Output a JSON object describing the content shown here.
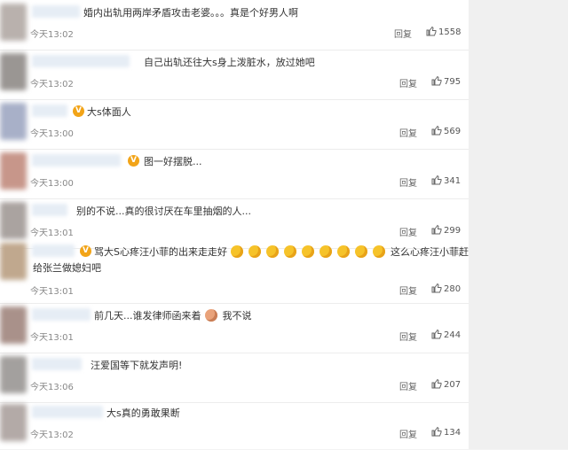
{
  "comments": [
    {
      "text": "婚内出轨用两岸矛盾攻击老婆。。。真是个好男人啊",
      "text2": "",
      "time": "今天13:02",
      "reply": "回复",
      "likes": "1558",
      "verified": false
    },
    {
      "text": "自己出轨还往大s身上泼脏水，放过她吧",
      "text2": "",
      "time": "今天13:02",
      "reply": "回复",
      "likes": "795",
      "verified": false
    },
    {
      "text": "大s体面人",
      "text2": "",
      "time": "今天13:00",
      "reply": "回复",
      "likes": "569",
      "verified": true
    },
    {
      "text": "图一好摆脱...",
      "text2": "",
      "time": "今天13:00",
      "reply": "回复",
      "likes": "341",
      "verified": true
    },
    {
      "text": "别的不说...真的很讨厌在车里抽烟的人...",
      "text2": "",
      "time": "今天13:01",
      "reply": "回复",
      "likes": "299",
      "verified": false
    },
    {
      "text": "骂大S心疼汪小菲的出来走走好",
      "text_after": "这么心疼汪小菲赶紧",
      "text2": "给张兰做媳妇吧",
      "time": "今天13:01",
      "reply": "回复",
      "likes": "280",
      "verified": true
    },
    {
      "text": "前几天...谁发律师函来着",
      "text_after": "我不说",
      "text2": "",
      "time": "今天13:01",
      "reply": "回复",
      "likes": "244",
      "verified": false
    },
    {
      "text": "汪爱国等下就发声明!",
      "text2": "",
      "time": "今天13:06",
      "reply": "回复",
      "likes": "207",
      "verified": false
    },
    {
      "text": "大s真的勇敢果断",
      "text2": "",
      "time": "今天13:02",
      "reply": "回复",
      "likes": "134",
      "verified": false
    }
  ],
  "icons": {
    "like": "thumbs-up-icon",
    "verified": "verified-badge-icon",
    "emoji": "laughing-emoji-icon"
  },
  "colors": {
    "verified": "#f2a418",
    "text": "#333333",
    "meta": "#888888"
  }
}
